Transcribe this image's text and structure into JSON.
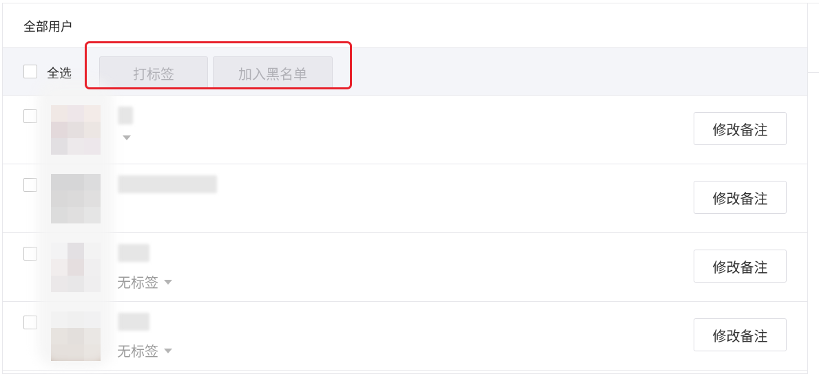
{
  "header": {
    "title": "全部用户"
  },
  "toolbar": {
    "select_all_label": "全选",
    "tag_button": "打标签",
    "blacklist_button": "加入黑名单"
  },
  "rows": [
    {
      "tag": "",
      "edit_note": "修改备注",
      "avatar_colors": [
        "#d7a390",
        "#c995a9",
        "#e9b6a1",
        "#7e3e4e",
        "#8e6566",
        "#b89683",
        "#7c6477",
        "#c3a6b4",
        "#c09bb6"
      ]
    },
    {
      "tag": "",
      "edit_note": "修改备注",
      "avatar_colors": [
        "#2d2a2f",
        "#2b2a2e",
        "#555257",
        "#3f3938",
        "#4a4442",
        "#6c6764",
        "#555050",
        "#6a6564",
        "#8f8c8b"
      ]
    },
    {
      "tag": "无标签",
      "edit_note": "修改备注",
      "avatar_colors": [
        "#ebe9ee",
        "#7f6d7f",
        "#e7e6ea",
        "#d9c4c4",
        "#8d6165",
        "#d3d1d6",
        "#b4a4a6",
        "#a39a9f",
        "#ccc9ce"
      ]
    },
    {
      "tag": "无标签",
      "edit_note": "修改备注",
      "avatar_colors": [
        "#e5e2e5",
        "#d8d5d8",
        "#dcdde2",
        "#9c7d65",
        "#7e6350",
        "#b09c88",
        "#8b6a51",
        "#8e6e55",
        "#a88a73"
      ]
    }
  ],
  "colors": {
    "highlight": "#e8212b",
    "toolbar_bg": "#f4f5f9",
    "border": "#e7e7eb"
  }
}
